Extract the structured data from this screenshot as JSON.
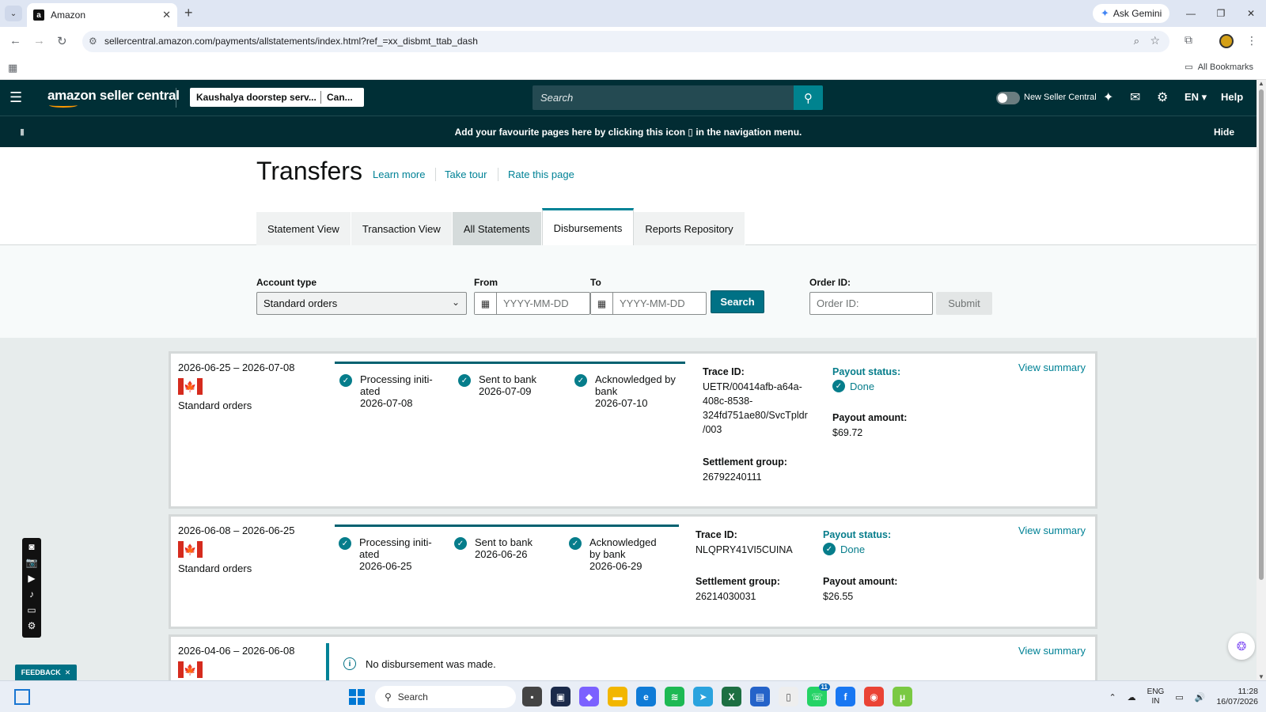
{
  "browser": {
    "tab_title": "Amazon",
    "tab_favicon": "a",
    "ask_gemini": "Ask Gemini",
    "url": "sellercentral.amazon.com/payments/allstatements/index.html?ref_=xx_disbmt_ttab_dash",
    "all_bookmarks": "All Bookmarks"
  },
  "header": {
    "logo_text": "amazon seller central",
    "store_name": "Kaushalya doorstep serv...",
    "store_region": "Can...",
    "search_placeholder": "Search",
    "new_seller_central": "New Seller Central",
    "language": "EN",
    "help": "Help"
  },
  "banner": {
    "text": "Add your favourite pages here by clicking this icon",
    "text_after": "in the navigation menu.",
    "hide": "Hide"
  },
  "page": {
    "title": "Transfers",
    "links": [
      "Learn more",
      "Take tour",
      "Rate this page"
    ],
    "tabs": [
      "Statement View",
      "Transaction View",
      "All Statements",
      "Disbursements",
      "Reports Repository"
    ],
    "active_tab": "Disbursements"
  },
  "filters": {
    "account_type_label": "Account type",
    "account_type_value": "Standard orders",
    "from_label": "From",
    "to_label": "To",
    "date_placeholder": "YYYY-MM-DD",
    "search_button": "Search",
    "order_id_label": "Order ID:",
    "order_id_placeholder": "Order ID:",
    "submit_button": "Submit"
  },
  "disbursements": [
    {
      "period": "2026-06-25 – 2026-07-08",
      "account": "Standard orders",
      "steps": [
        {
          "title": "Processing initi-",
          "title2": "ated",
          "date": "2026-07-08"
        },
        {
          "title": "Sent to bank",
          "title2": "",
          "date": "2026-07-09"
        },
        {
          "title": "Acknowledged by",
          "title2": "bank",
          "date": "2026-07-10"
        }
      ],
      "trace_label": "Trace ID:",
      "trace_lines": [
        "UETR/00414afb-a64a-",
        "408c-8538-",
        "324fd751ae80/SvcTpldr",
        "/003"
      ],
      "settlement_label": "Settlement group:",
      "settlement_group": "26792240111",
      "payout_status_label": "Payout status:",
      "payout_status": "Done",
      "payout_amount_label": "Payout amount:",
      "payout_amount": "$69.72",
      "view_summary": "View summary"
    },
    {
      "period": "2026-06-08 – 2026-06-25",
      "account": "Standard orders",
      "steps": [
        {
          "title": "Processing initi-",
          "title2": "ated",
          "date": "2026-06-25"
        },
        {
          "title": "Sent to bank",
          "title2": "",
          "date": "2026-06-26"
        },
        {
          "title": "Acknowledged",
          "title2": "by bank",
          "date": "2026-06-29"
        }
      ],
      "trace_label": "Trace ID:",
      "trace_lines": [
        "NLQPRY41VI5CUINA"
      ],
      "settlement_label": "Settlement group:",
      "settlement_group": "26214030031",
      "payout_status_label": "Payout status:",
      "payout_status": "Done",
      "payout_amount_label": "Payout amount:",
      "payout_amount": "$26.55",
      "view_summary": "View summary"
    },
    {
      "period": "2026-04-06 – 2026-06-08",
      "no_disbursement": "No disbursement was made.",
      "view_summary": "View summary"
    }
  ],
  "overlays": {
    "feedback": "FEEDBACK"
  },
  "taskbar": {
    "search": "Search",
    "badge": "11",
    "lang_1": "ENG",
    "lang_2": "IN",
    "time": "11:28",
    "date": "16/07/2026"
  }
}
